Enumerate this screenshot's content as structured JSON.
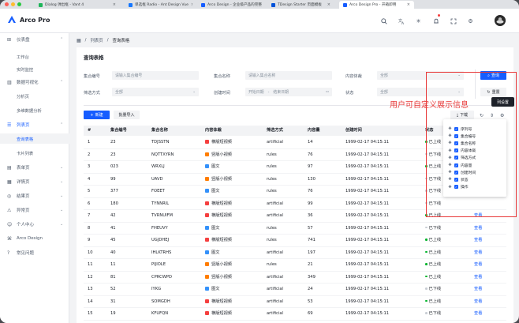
{
  "browser": {
    "tabs": [
      {
        "title": "Dialog 弹出框 - Vant 4",
        "favicon_color": "#1fb55a",
        "active": false
      },
      {
        "title": "单选框 Radio - Ant Design Vue",
        "favicon_color": "#1677ff",
        "active": false
      },
      {
        "title": "Arco Design - 企业级产品的完整",
        "favicon_color": "#165dff",
        "active": false
      },
      {
        "title": "TDesign Starter 页面模板",
        "favicon_color": "#0052d9",
        "active": false
      },
      {
        "title": "Arco Design Pro - 开箱即用",
        "favicon_color": "#165dff",
        "active": true
      }
    ]
  },
  "header": {
    "app_name": "Arco Pro",
    "icons": [
      "search-icon",
      "translate-icon",
      "sun-icon",
      "bell-icon",
      "fullscreen-icon",
      "settings-icon"
    ]
  },
  "sidebar": {
    "items": [
      {
        "type": "group",
        "icon": "dashboard-icon",
        "label": "仪表盘",
        "chevron": "^"
      },
      {
        "type": "sub",
        "label": "工作台",
        "active": false
      },
      {
        "type": "sub",
        "label": "实时监控",
        "active": false
      },
      {
        "type": "group",
        "icon": "chart-icon",
        "label": "数据可视化",
        "chevron": "^"
      },
      {
        "type": "sub",
        "label": "分析页",
        "active": false
      },
      {
        "type": "sub",
        "label": "多维数据分析",
        "active": false
      },
      {
        "type": "group",
        "icon": "list-icon",
        "label": "列表页",
        "chevron": "^",
        "active": true
      },
      {
        "type": "sub",
        "label": "查询表格",
        "active": true
      },
      {
        "type": "sub",
        "label": "卡片列表",
        "active": false
      },
      {
        "type": "group",
        "icon": "form-icon",
        "label": "表单页",
        "chevron": "v"
      },
      {
        "type": "group",
        "icon": "detail-icon",
        "label": "详情页",
        "chevron": "v"
      },
      {
        "type": "group",
        "icon": "result-icon",
        "label": "结果页",
        "chevron": "v"
      },
      {
        "type": "group",
        "icon": "exception-icon",
        "label": "异常页",
        "chevron": "v"
      },
      {
        "type": "group",
        "icon": "user-icon",
        "label": "个人中心",
        "chevron": "v"
      },
      {
        "type": "group",
        "icon": "link-icon",
        "label": "Arco Design",
        "chevron": ""
      },
      {
        "type": "group",
        "icon": "question-icon",
        "label": "常见问题",
        "chevron": ""
      }
    ]
  },
  "breadcrumb": {
    "level1": "列表页",
    "sep": "/",
    "level2": "查询表格"
  },
  "page": {
    "title": "查询表格"
  },
  "filters": {
    "collection_id": {
      "label": "集合编号",
      "placeholder": "请输入集合编号"
    },
    "collection_name": {
      "label": "集合名称",
      "placeholder": "请输入集合名称"
    },
    "content_type": {
      "label": "内容体裁",
      "value": "全部"
    },
    "filter_type": {
      "label": "筛选方式",
      "value": "全部"
    },
    "created_time": {
      "label": "创建时间",
      "start": "开始日期",
      "end": "结束日期",
      "sep": "-"
    },
    "status": {
      "label": "状态",
      "value": "全部"
    }
  },
  "actions": {
    "search": "查询",
    "reset": "重置",
    "new": "新建",
    "batch_import": "批量导入",
    "download": "下载"
  },
  "table": {
    "columns": [
      "#",
      "集合编号",
      "集合名称",
      "内容体裁",
      "筛选方式",
      "内容量",
      "创建时间",
      "状态",
      "操作"
    ],
    "rows": [
      {
        "idx": "1",
        "id": "23",
        "name": "TDJSSTN",
        "ctype": "横版短视频",
        "ctype_key": "horizontal",
        "filter": "artificial",
        "count": "14",
        "time": "1999-02-17 04:15:11",
        "status": "已上线",
        "online": true
      },
      {
        "idx": "2",
        "id": "23",
        "name": "NQTTXYRN",
        "ctype": "竖版小视频",
        "ctype_key": "vertical",
        "filter": "rules",
        "count": "76",
        "time": "1999-02-17 04:15:11",
        "status": "已下线",
        "online": false
      },
      {
        "idx": "3",
        "id": "023",
        "name": "WRXLJ",
        "ctype": "图文",
        "ctype_key": "image",
        "filter": "rules",
        "count": "97",
        "time": "1999-02-17 04:15:11",
        "status": "已上线",
        "online": true
      },
      {
        "idx": "4",
        "id": "99",
        "name": "UAVD",
        "ctype": "竖版小视频",
        "ctype_key": "vertical",
        "filter": "rules",
        "count": "130",
        "time": "1999-02-17 04:15:11",
        "status": "已下线",
        "online": false
      },
      {
        "idx": "5",
        "id": "377",
        "name": "FOEET",
        "ctype": "图文",
        "ctype_key": "image",
        "filter": "rules",
        "count": "76",
        "time": "1999-02-17 04:15:11",
        "status": "已下线",
        "online": false
      },
      {
        "idx": "6",
        "id": "180",
        "name": "TYNNRIL",
        "ctype": "横版短视频",
        "ctype_key": "horizontal",
        "filter": "artificial",
        "count": "99",
        "time": "1999-02-17 04:15:11",
        "status": "已下线",
        "online": false
      },
      {
        "idx": "7",
        "id": "42",
        "name": "TVRNUIFM",
        "ctype": "横版短视频",
        "ctype_key": "horizontal",
        "filter": "artificial",
        "count": "36",
        "time": "1999-02-17 04:15:11",
        "status": "已上线",
        "online": true,
        "op": "查看"
      },
      {
        "idx": "8",
        "id": "41",
        "name": "FHEUVY",
        "ctype": "图文",
        "ctype_key": "image",
        "filter": "rules",
        "count": "57",
        "time": "1999-02-17 04:15:11",
        "status": "已下线",
        "online": false,
        "op": "查看"
      },
      {
        "idx": "9",
        "id": "45",
        "name": "UGJDHEJ",
        "ctype": "横版短视频",
        "ctype_key": "horizontal",
        "filter": "rules",
        "count": "741",
        "time": "1999-02-17 04:15:11",
        "status": "已上线",
        "online": true,
        "op": "查看"
      },
      {
        "idx": "10",
        "id": "40",
        "name": "IHLKTRHS",
        "ctype": "图文",
        "ctype_key": "image",
        "filter": "artificial",
        "count": "197",
        "time": "1999-02-17 04:15:11",
        "status": "已上线",
        "online": true,
        "op": "查看"
      },
      {
        "idx": "11",
        "id": "11",
        "name": "PIJIOLE",
        "ctype": "竖版小视频",
        "ctype_key": "vertical",
        "filter": "rules",
        "count": "21",
        "time": "1999-02-17 04:15:11",
        "status": "已上线",
        "online": true,
        "op": "查看"
      },
      {
        "idx": "12",
        "id": "81",
        "name": "CPRCWPD",
        "ctype": "竖版小视频",
        "ctype_key": "vertical",
        "filter": "artificial",
        "count": "349",
        "time": "1999-02-17 04:15:11",
        "status": "已上线",
        "online": true,
        "op": "查看"
      },
      {
        "idx": "13",
        "id": "52",
        "name": "IYKG",
        "ctype": "图文",
        "ctype_key": "image",
        "filter": "artificial",
        "count": "24",
        "time": "1999-02-17 04:15:11",
        "status": "已下线",
        "online": false,
        "op": "查看"
      },
      {
        "idx": "14",
        "id": "31",
        "name": "SOMGDH",
        "ctype": "横版短视频",
        "ctype_key": "horizontal",
        "filter": "artificial",
        "count": "53",
        "time": "1999-02-17 04:15:11",
        "status": "已上线",
        "online": true,
        "op": "查看"
      },
      {
        "idx": "15",
        "id": "19",
        "name": "KFUFQN",
        "ctype": "横版短视频",
        "ctype_key": "horizontal",
        "filter": "artificial",
        "count": "69",
        "time": "1999-02-17 04:15:11",
        "status": "已下线",
        "online": false,
        "op": "查看"
      }
    ]
  },
  "column_settings": {
    "tooltip": "列设置",
    "items": [
      "序列号",
      "集合编号",
      "集合名称",
      "内容体裁",
      "筛选方式",
      "内容量",
      "创建时间",
      "状态",
      "操作"
    ]
  },
  "annotation": {
    "text": "用户可自定义展示信息",
    "color": "#e83a3a"
  },
  "colors": {
    "primary": "#165dff",
    "online": "#00b42a",
    "offline": "#c9cdd4",
    "horizontal": "#f53f3f",
    "vertical": "#ff7d00",
    "image": "#3491fa"
  }
}
